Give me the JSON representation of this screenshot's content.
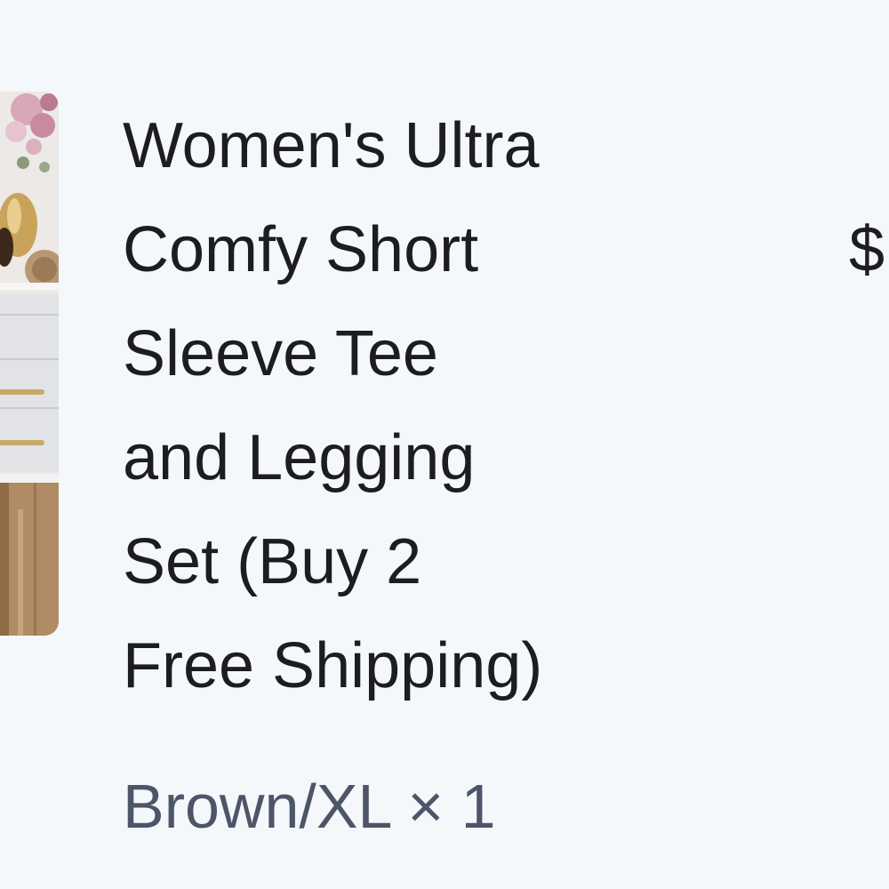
{
  "order_item": {
    "title_lines": [
      "Women's Ultra",
      "Comfy Short",
      "Sleeve Tee",
      "and Legging",
      "Set (Buy 2",
      "Free Shipping)"
    ],
    "variant": "Brown/XL × 1",
    "price_visible": "$"
  },
  "colors": {
    "background": "#f5f8fb",
    "title_text": "#1d1d1f",
    "variant_text": "#4d5569"
  }
}
